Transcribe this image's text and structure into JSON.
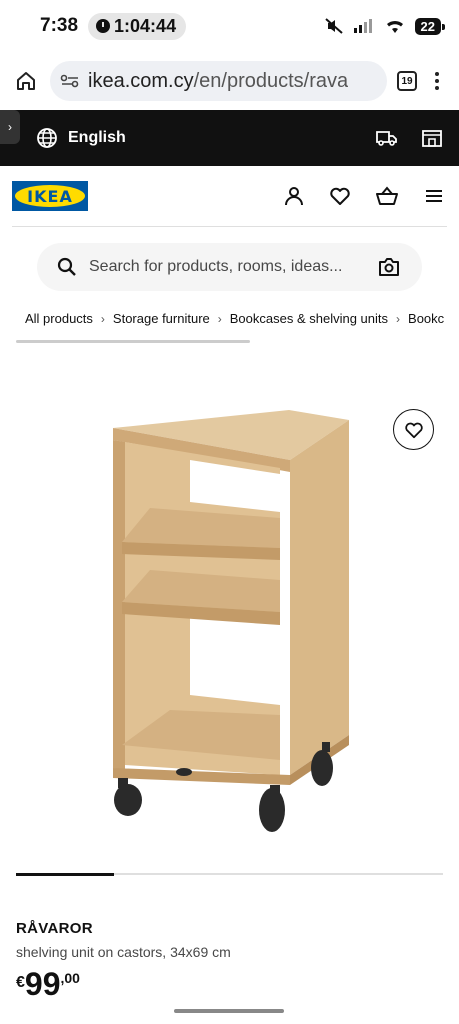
{
  "status_bar": {
    "time": "7:38",
    "timer": "1:04:44",
    "battery": "22"
  },
  "browser": {
    "url_domain": "ikea.com.cy",
    "url_path": "/en/products/rava",
    "tab_count": "19"
  },
  "top_bar": {
    "language": "English"
  },
  "header": {
    "logo_text": "IKEA"
  },
  "search": {
    "placeholder": "Search for products, rooms, ideas..."
  },
  "breadcrumb": {
    "items": [
      "All products",
      "Storage furniture",
      "Bookcases & shelving units",
      "Bookc"
    ],
    "separator": "›"
  },
  "image_progress": {
    "current_fraction": 0.23
  },
  "product": {
    "name": "RÅVAROR",
    "description": "shelving unit on castors, 34x69 cm",
    "price_currency": "€",
    "price_integer": "99",
    "price_decimals": ",00"
  },
  "colors": {
    "ikea_blue": "#0058a3",
    "ikea_yellow": "#ffdb00",
    "top_bar": "#111111",
    "wood": "#d8b88a"
  }
}
